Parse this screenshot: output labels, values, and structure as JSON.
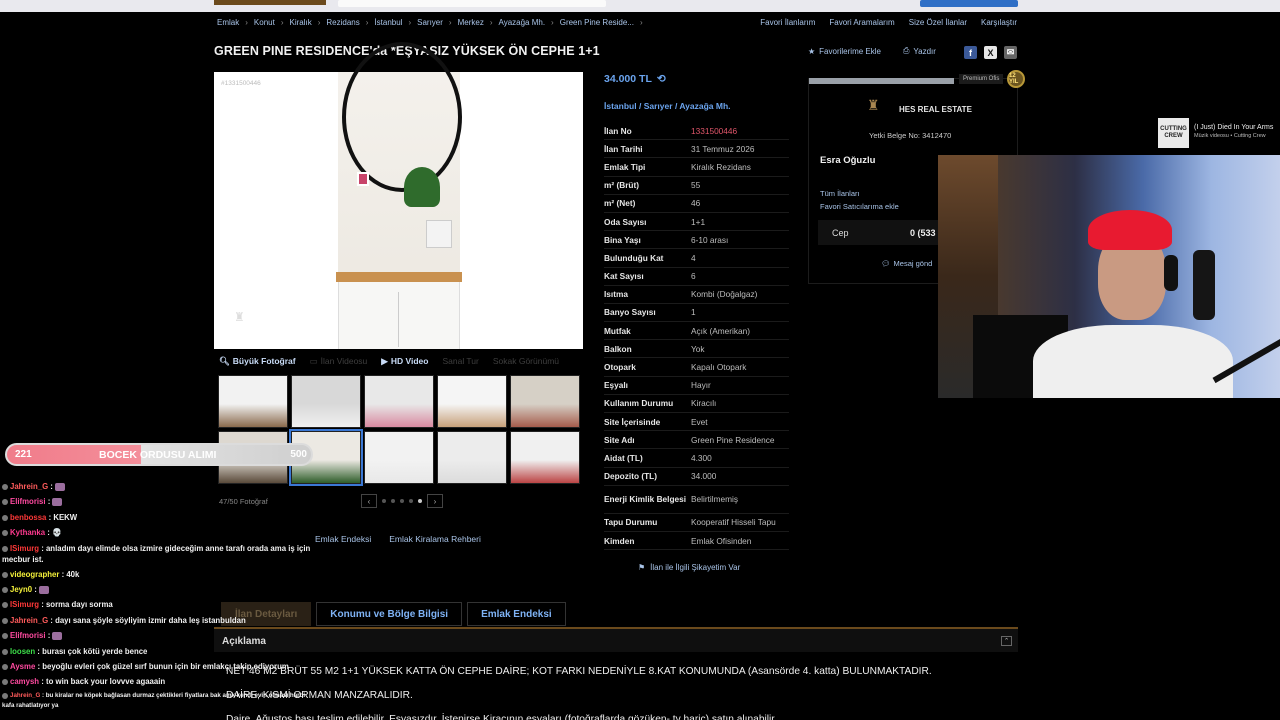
{
  "breadcrumbs": [
    "Emlak",
    "Konut",
    "Kiralık",
    "Rezidans",
    "İstanbul",
    "Sarıyer",
    "Merkez",
    "Ayazağa Mh.",
    "Green Pine Reside..."
  ],
  "breadcrumb_sep": "›",
  "top_links": [
    "Favori İlanlarım",
    "Favori Aramalarım",
    "Size Özel İlanlar",
    "Karşılaştır"
  ],
  "listing_title": "GREEN PINE RESIDENCE'da *EŞYASIZ YÜKSEK ÖN CEPHE 1+1",
  "actions": {
    "favorite": "Favorilerime Ekle",
    "print": "Yazdır"
  },
  "social": {
    "facebook": "f",
    "x": "X",
    "mail": "✉"
  },
  "photo_id": "#1331500446",
  "media_tabs": {
    "big_photo": "Büyük Fotoğraf",
    "video": "İlan Videosu",
    "hd_video": "HD Video",
    "virtual_tour": "Sanal Tur",
    "street_view": "Sokak Görünümü"
  },
  "gallery": {
    "count": "47/50 Fotoğraf",
    "prev": "‹",
    "next": "›"
  },
  "below_links": [
    "Emlak Endeksi",
    "Emlak Kiralama Rehberi"
  ],
  "price": "34.000 TL",
  "location": {
    "city": "İstanbul",
    "district": "Sarıyer",
    "neighborhood": "Ayazağa Mh.",
    "sep": "/"
  },
  "details": [
    {
      "k": "İlan No",
      "v": "1331500446"
    },
    {
      "k": "İlan Tarihi",
      "v": "31 Temmuz 2026"
    },
    {
      "k": "Emlak Tipi",
      "v": "Kiralık Rezidans"
    },
    {
      "k": "m² (Brüt)",
      "v": "55"
    },
    {
      "k": "m² (Net)",
      "v": "46"
    },
    {
      "k": "Oda Sayısı",
      "v": "1+1"
    },
    {
      "k": "Bina Yaşı",
      "v": "6-10 arası"
    },
    {
      "k": "Bulunduğu Kat",
      "v": "4"
    },
    {
      "k": "Kat Sayısı",
      "v": "6"
    },
    {
      "k": "Isıtma",
      "v": "Kombi (Doğalgaz)"
    },
    {
      "k": "Banyo Sayısı",
      "v": "1"
    },
    {
      "k": "Mutfak",
      "v": "Açık (Amerikan)"
    },
    {
      "k": "Balkon",
      "v": "Yok"
    },
    {
      "k": "Otopark",
      "v": "Kapalı Otopark"
    },
    {
      "k": "Eşyalı",
      "v": "Hayır"
    },
    {
      "k": "Kullanım Durumu",
      "v": "Kiracılı"
    },
    {
      "k": "Site İçerisinde",
      "v": "Evet"
    },
    {
      "k": "Site Adı",
      "v": "Green Pine Residence"
    },
    {
      "k": "Aidat (TL)",
      "v": "4.300"
    },
    {
      "k": "Depozito (TL)",
      "v": "34.000"
    },
    {
      "k": "Enerji Kimlik Belgesi",
      "v": "Belirtilmemiş"
    },
    {
      "k": "Tapu Durumu",
      "v": "Kooperatif Hisseli Tapu"
    },
    {
      "k": "Kimden",
      "v": "Emlak Ofisinden"
    }
  ],
  "complaint": "İlan ile İlgili Şikayetim Var",
  "agent": {
    "badge": "Premium Ofis",
    "coin": "12 YIL",
    "firm": "HES REAL ESTATE",
    "license_label": "Yetki Belge No:",
    "license_no": "3412470",
    "name": "Esra Oğuzlu",
    "all_listings": "Tüm İlanları",
    "favorite_seller": "Favori Satıcılarıma ekle",
    "phone_label": "Cep",
    "phone_value": "0 (533",
    "message": "Mesaj gönd"
  },
  "tabs": [
    "İlan Detayları",
    "Konumu ve Bölge Bilgisi",
    "Emlak Endeksi"
  ],
  "description_header": "Açıklama",
  "description_lines": [
    "NET 46 M2 BRÜT 55 M2 1+1 YÜKSEK KATTA ÖN CEPHE DAİRE; KOT FARKI NEDENİYLE 8.KAT KONUMUNDA (Asansörde 4. katta) BULUNMAKTADIR.",
    "DAİRE, KISMİ ORMAN MANZARALIDIR.",
    "Daire, Ağustos başı teslim edilebilir. Eşyasızdır. İstenirse Kiracının eşyaları (fotoğraflarda gözüken- tv hariç) satın alınabilir."
  ],
  "now_playing": {
    "art": "CUTTING CREW",
    "title": "(I Just) Died In Your Arms",
    "subtitle": "Müzik videosu • Cutting Crew"
  },
  "goal_bar": {
    "left": "221",
    "title": "BOCEK ORDUSU ALIMI",
    "right": "500",
    "progress": 0.44
  },
  "chat": [
    {
      "user": "Jahrein_G",
      "color": "#ff5b5b",
      "text": ""
    },
    {
      "user": "Elifmorisi",
      "color": "#ff4aa0",
      "text": ""
    },
    {
      "user": "benbossa",
      "color": "#ff3838",
      "text": "KEKW"
    },
    {
      "user": "Kythanka",
      "color": "#ff3a8f",
      "text": "💀"
    },
    {
      "user": "ISimurg",
      "color": "#ff3838",
      "text": "anladım dayı elimde olsa izmire gideceğim anne tarafı orada ama iş için mecbur ist."
    },
    {
      "user": "videographer",
      "color": "#f5f23a",
      "text": "40k"
    },
    {
      "user": "Jeyn0",
      "color": "#f5f23a",
      "text": ""
    },
    {
      "user": "ISimurg",
      "color": "#ff3838",
      "text": "sorma dayı sorma"
    },
    {
      "user": "Jahrein_G",
      "color": "#ff5b5b",
      "text": "dayı sana şöyle söyliyim izmir daha leş istanbuldan"
    },
    {
      "user": "Elifmorisi",
      "color": "#ff4aa0",
      "text": ""
    },
    {
      "user": "loosen",
      "color": "#3de04a",
      "text": "burası çok kötü yerde bence"
    },
    {
      "user": "Aysme",
      "color": "#ff4aa0",
      "text": "beyoğlu evleri çok güzel sırf bunun için bir emlakçı takip ediyorum"
    },
    {
      "user": "camysh",
      "color": "#ff4aa0",
      "text": "to win back your lovvve agaaain"
    },
    {
      "user": "Jahrein_G",
      "color": "#ff5b5b",
      "text": "bu kiralar ne köpek bağlasan durmaz çektikleri fiyatlara bak amk kendi evin olması harbi kafa rahatlatıyor ya"
    }
  ]
}
